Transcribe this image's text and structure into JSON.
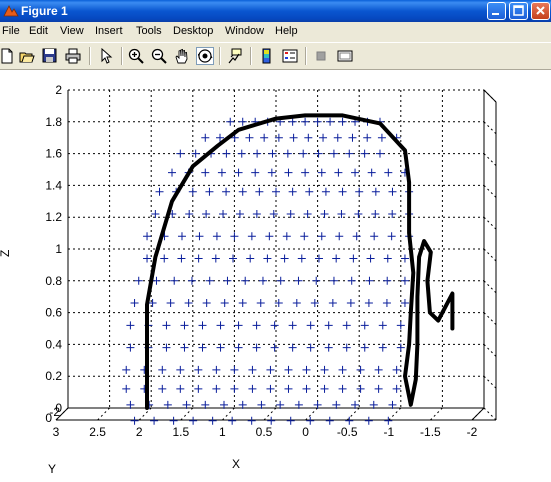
{
  "window": {
    "title": "Figure 1"
  },
  "menu": [
    "File",
    "Edit",
    "View",
    "Insert",
    "Tools",
    "Desktop",
    "Window",
    "Help"
  ],
  "toolbar": {
    "buttons": [
      {
        "name": "new-figure-icon"
      },
      {
        "name": "open-file-icon"
      },
      {
        "name": "save-icon"
      },
      {
        "name": "print-icon"
      },
      {
        "name": "edit-plot-arrow-icon"
      },
      {
        "name": "zoom-in-icon"
      },
      {
        "name": "zoom-out-icon"
      },
      {
        "name": "pan-hand-icon"
      },
      {
        "name": "rotate-3d-icon"
      },
      {
        "name": "data-cursor-icon"
      },
      {
        "name": "colorbar-icon"
      },
      {
        "name": "legend-icon"
      },
      {
        "name": "hide-plot-tools-icon"
      },
      {
        "name": "show-plot-tools-icon"
      }
    ]
  },
  "colors": {
    "titlebar": "#0a56d0",
    "markers": "#0a1e9c",
    "curve": "#000000",
    "grid": "#000000"
  },
  "chart_data": {
    "type": "scatter",
    "view": "3d",
    "grid": true,
    "xlabel": "X",
    "ylabel": "Y",
    "zlabel": "Z",
    "x_ticks": [
      "3",
      "2.5",
      "2",
      "1.5",
      "1",
      "0.5",
      "0",
      "-0.5",
      "-1",
      "-1.5",
      "-2"
    ],
    "y_ticks": [
      "-2",
      "0"
    ],
    "z_ticks": [
      "0",
      "0.2",
      "0.4",
      "0.6",
      "0.8",
      "1",
      "1.2",
      "1.4",
      "1.6",
      "1.8",
      "2"
    ],
    "xlim": [
      3,
      -2
    ],
    "zlim": [
      0,
      2
    ],
    "series": [
      {
        "style": "blue plus markers",
        "rows": [
          {
            "z": 1.8,
            "x_from": 1.05,
            "x_to": -0.75,
            "count": 13
          },
          {
            "z": 1.7,
            "x_from": 1.35,
            "x_to": -0.95,
            "count": 14
          },
          {
            "z": 1.6,
            "x_from": 1.65,
            "x_to": -0.75,
            "count": 14
          },
          {
            "z": 1.48,
            "x_from": 1.75,
            "x_to": -1.05,
            "count": 15
          },
          {
            "z": 1.36,
            "x_from": 1.9,
            "x_to": -1.1,
            "count": 16
          },
          {
            "z": 1.22,
            "x_from": 1.95,
            "x_to": -1.1,
            "count": 16
          },
          {
            "z": 1.08,
            "x_from": 2.05,
            "x_to": -1.1,
            "count": 16
          },
          {
            "z": 0.94,
            "x_from": 2.05,
            "x_to": -1.05,
            "count": 16
          },
          {
            "z": 0.8,
            "x_from": 2.15,
            "x_to": -1.05,
            "count": 16
          },
          {
            "z": 0.66,
            "x_from": 2.2,
            "x_to": -1.05,
            "count": 16
          },
          {
            "z": 0.52,
            "x_from": 2.25,
            "x_to": -1.0,
            "count": 16
          },
          {
            "z": 0.38,
            "x_from": 2.25,
            "x_to": -1.0,
            "count": 16
          },
          {
            "z": 0.24,
            "x_from": 2.3,
            "x_to": -0.95,
            "count": 16
          },
          {
            "z": 0.12,
            "x_from": 2.3,
            "x_to": -0.95,
            "count": 16
          },
          {
            "z": 0.02,
            "x_from": 2.25,
            "x_to": -0.9,
            "count": 15
          },
          {
            "z": -0.08,
            "x_from": 2.2,
            "x_to": -0.85,
            "count": 14
          }
        ]
      },
      {
        "style": "thick black line",
        "points": [
          [
            2.05,
            0.0
          ],
          [
            2.05,
            0.35
          ],
          [
            2.05,
            0.65
          ],
          [
            1.95,
            0.95
          ],
          [
            1.75,
            1.3
          ],
          [
            1.5,
            1.52
          ],
          [
            1.2,
            1.65
          ],
          [
            0.95,
            1.75
          ],
          [
            0.5,
            1.82
          ],
          [
            0.15,
            1.84
          ],
          [
            -0.3,
            1.84
          ],
          [
            -0.75,
            1.79
          ],
          [
            -1.05,
            1.62
          ],
          [
            -1.1,
            1.42
          ],
          [
            -1.1,
            1.1
          ],
          [
            -1.15,
            0.85
          ],
          [
            -1.12,
            0.6
          ],
          [
            -1.1,
            0.4
          ],
          [
            -1.05,
            0.2
          ],
          [
            -1.12,
            0.02
          ],
          [
            -1.18,
            0.18
          ],
          [
            -1.2,
            0.4
          ],
          [
            -1.2,
            0.7
          ],
          [
            -1.22,
            0.95
          ],
          [
            -1.28,
            1.05
          ],
          [
            -1.36,
            0.98
          ],
          [
            -1.32,
            0.8
          ],
          [
            -1.35,
            0.6
          ],
          [
            -1.45,
            0.55
          ],
          [
            -1.55,
            0.65
          ],
          [
            -1.62,
            0.72
          ],
          [
            -1.62,
            0.5
          ]
        ]
      }
    ]
  }
}
